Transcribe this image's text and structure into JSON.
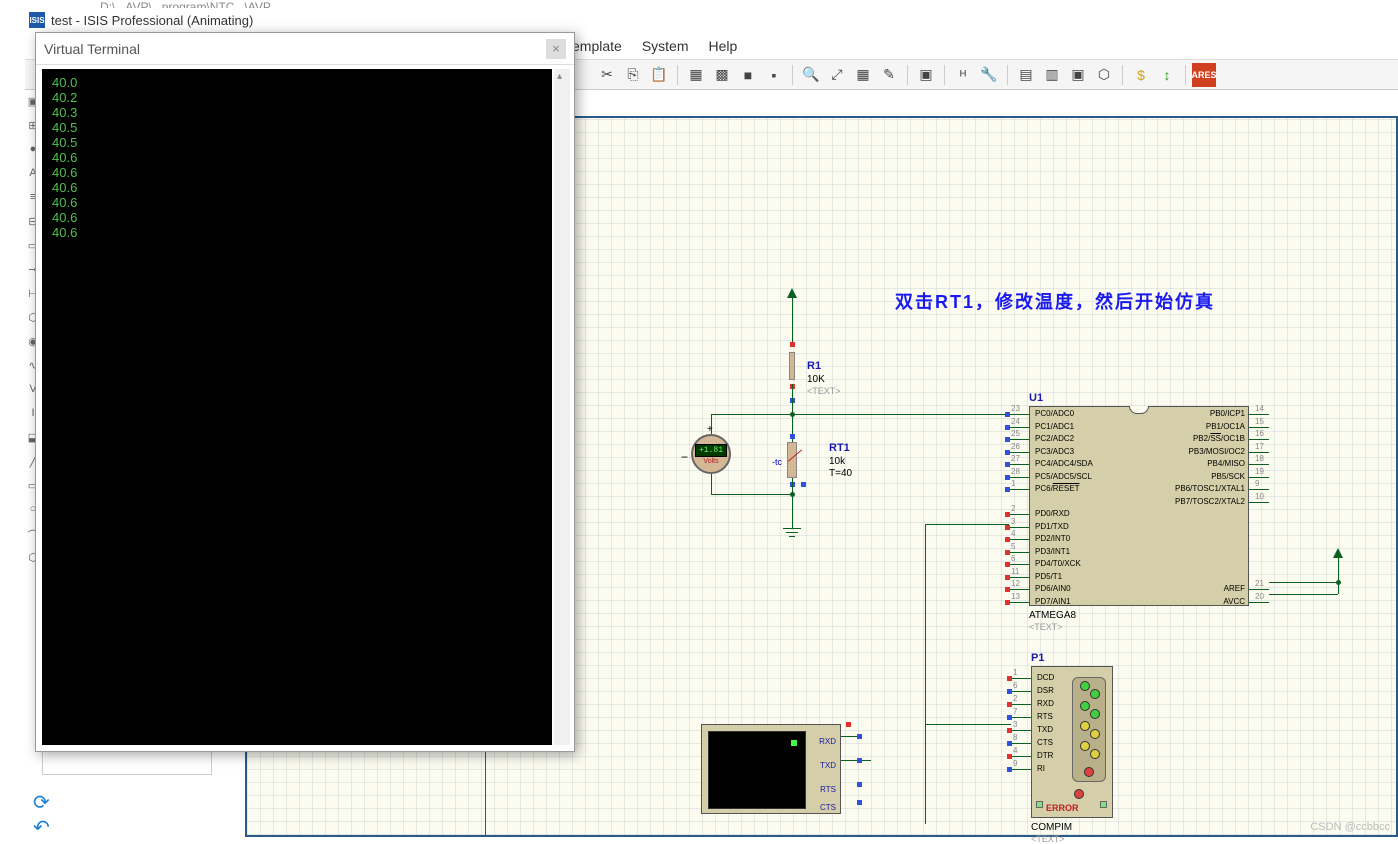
{
  "path_hint": "D:\\...AVP\\...program\\NTC...\\AVP",
  "title": "test - ISIS Professional (Animating)",
  "menu": {
    "template": "Template",
    "system": "System",
    "help": "Help"
  },
  "terminal": {
    "title": "Virtual Terminal",
    "lines": [
      "40.0",
      "40.2",
      "40.3",
      "40.5",
      "40.5",
      "40.6",
      "40.6",
      "40.6",
      "40.6",
      "40.6",
      "40.6"
    ]
  },
  "instruction": "双击RT1，修改温度，然后开始仿真",
  "r1": {
    "name": "R1",
    "value": "10K",
    "text": "<TEXT>"
  },
  "rt1": {
    "name": "RT1",
    "value": "10k",
    "temp": "T=40",
    "tc": "-tc"
  },
  "voltmeter": {
    "reading": "+1.81",
    "unit": "Volts"
  },
  "u1": {
    "name": "U1",
    "part": "ATMEGA8",
    "text": "<TEXT>",
    "left_pins": [
      {
        "n": "23",
        "l": "PC0/ADC0"
      },
      {
        "n": "24",
        "l": "PC1/ADC1"
      },
      {
        "n": "25",
        "l": "PC2/ADC2"
      },
      {
        "n": "26",
        "l": "PC3/ADC3"
      },
      {
        "n": "27",
        "l": "PC4/ADC4/SDA"
      },
      {
        "n": "28",
        "l": "PC5/ADC5/SCL"
      },
      {
        "n": "1",
        "l": "PC6/RESET"
      },
      {
        "n": "2",
        "l": "PD0/RXD"
      },
      {
        "n": "3",
        "l": "PD1/TXD"
      },
      {
        "n": "4",
        "l": "PD2/INT0"
      },
      {
        "n": "5",
        "l": "PD3/INT1"
      },
      {
        "n": "6",
        "l": "PD4/T0/XCK"
      },
      {
        "n": "11",
        "l": "PD5/T1"
      },
      {
        "n": "12",
        "l": "PD6/AIN0"
      },
      {
        "n": "13",
        "l": "PD7/AIN1"
      }
    ],
    "right_pins": [
      {
        "n": "14",
        "l": "PB0/ICP1"
      },
      {
        "n": "15",
        "l": "PB1/OC1A"
      },
      {
        "n": "16",
        "l": "PB2/SS/OC1B"
      },
      {
        "n": "17",
        "l": "PB3/MOSI/OC2"
      },
      {
        "n": "18",
        "l": "PB4/MISO"
      },
      {
        "n": "19",
        "l": "PB5/SCK"
      },
      {
        "n": "9",
        "l": "PB6/TOSC1/XTAL1"
      },
      {
        "n": "10",
        "l": "PB7/TOSC2/XTAL2"
      },
      {
        "n": "21",
        "l": "AREF"
      },
      {
        "n": "20",
        "l": "AVCC"
      }
    ]
  },
  "serial": {
    "pins": [
      "RXD",
      "TXD",
      "RTS",
      "CTS"
    ]
  },
  "p1": {
    "name": "P1",
    "part": "COMPIM",
    "text": "<TEXT>",
    "error": "ERROR",
    "pins": [
      {
        "n": "1",
        "l": "DCD"
      },
      {
        "n": "6",
        "l": "DSR"
      },
      {
        "n": "2",
        "l": "RXD"
      },
      {
        "n": "7",
        "l": "RTS"
      },
      {
        "n": "3",
        "l": "TXD"
      },
      {
        "n": "8",
        "l": "CTS"
      },
      {
        "n": "4",
        "l": "DTR"
      },
      {
        "n": "9",
        "l": "RI"
      }
    ]
  },
  "watermark": "CSDN @ccbbcc"
}
